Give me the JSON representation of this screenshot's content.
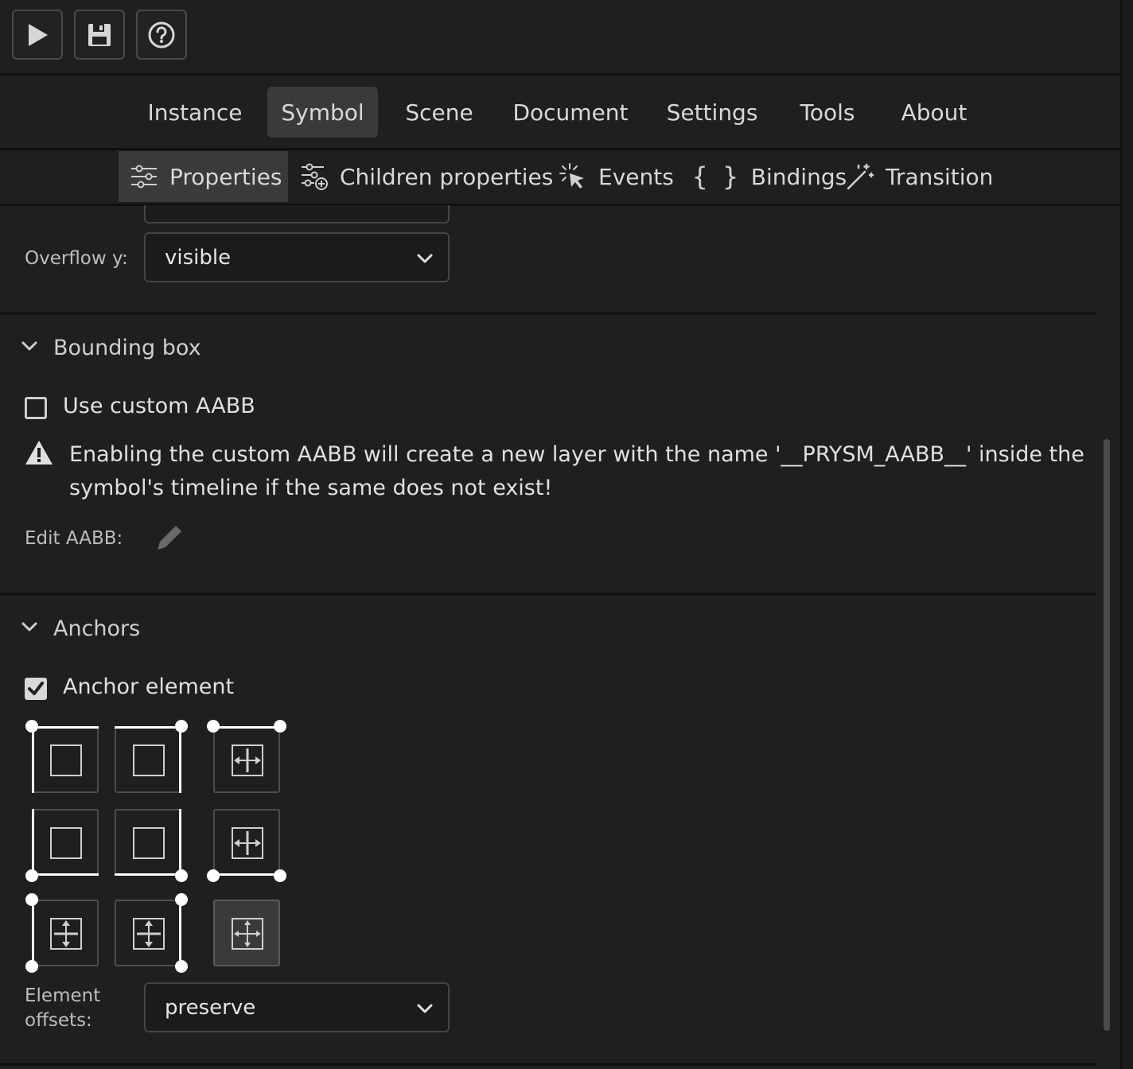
{
  "toolbar": {
    "buttons": [
      {
        "icon": "play-icon"
      },
      {
        "icon": "save-icon"
      },
      {
        "icon": "help-icon"
      }
    ]
  },
  "main_tabs": [
    {
      "label": "Instance",
      "active": false
    },
    {
      "label": "Symbol",
      "active": true
    },
    {
      "label": "Scene",
      "active": false
    },
    {
      "label": "Document",
      "active": false
    },
    {
      "label": "Settings",
      "active": false
    },
    {
      "label": "Tools",
      "active": false
    },
    {
      "label": "About",
      "active": false
    }
  ],
  "sub_tabs": [
    {
      "label": "Properties",
      "icon": "sliders-icon",
      "active": true
    },
    {
      "label": "Children properties",
      "icon": "sliders-add-icon",
      "active": false
    },
    {
      "label": "Events",
      "icon": "cursor-click-icon",
      "active": false
    },
    {
      "label": "Bindings",
      "icon": "braces-icon",
      "active": false
    },
    {
      "label": "Transition",
      "icon": "magic-wand-icon",
      "active": false
    }
  ],
  "overflow": {
    "y_label": "Overflow y:",
    "y_value": "visible"
  },
  "bounding_box": {
    "title": "Bounding box",
    "custom_aabb_label": "Use custom AABB",
    "custom_aabb_checked": false,
    "warning_line1": "Enabling the custom AABB will create a new layer with the name '__PRYSM_AABB__' inside the",
    "warning_line2": "symbol's timeline if the same does not exist!",
    "edit_label": "Edit AABB:"
  },
  "anchors": {
    "title": "Anchors",
    "anchor_element_label": "Anchor element",
    "anchor_element_checked": true,
    "offsets_label_1": "Element",
    "offsets_label_2": "offsets:",
    "offsets_value": "preserve",
    "selected_cell": "stretch-both"
  },
  "colors": {
    "background": "#1f1f1f",
    "active_tab": "#3a3a3a",
    "text": "#d9d9d9",
    "anchor_edge": "#ffffff"
  }
}
